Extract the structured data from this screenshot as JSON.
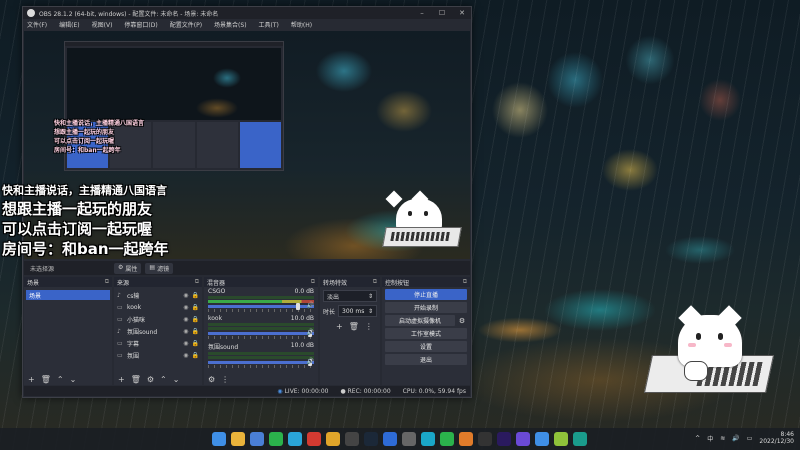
{
  "window": {
    "title": "OBS 28.1.2 (64-bit, windows) - 配置文件: 未命名 - 场景: 未命名",
    "controls": [
      "–",
      "☐",
      "✕"
    ]
  },
  "menu": [
    "文件(F)",
    "编辑(E)",
    "视图(V)",
    "停靠窗口(D)",
    "配置文件(P)",
    "场景集合(S)",
    "工具(T)",
    "帮助(H)"
  ],
  "overlay_lines_small": [
    "快和主播说话，主播精通八国语言",
    "想跟主播一起玩的朋友",
    "可以点击订阅一起玩喔",
    "房间号：和ban一起跨年"
  ],
  "overlay_lines_big": [
    "快和主播说话，主播精通八国语言",
    "想跟主播一起玩的朋友",
    "可以点击订阅一起玩喔",
    "房间号：和ban一起跨年"
  ],
  "scenebar": {
    "scene_label": "未选择源",
    "props_label": "属性",
    "filters_label": "滤镜"
  },
  "docks": {
    "scenes": {
      "title": "场景",
      "items": [
        "场景"
      ]
    },
    "sources": {
      "title": "来源",
      "items": [
        {
          "icon": "♪",
          "label": "cs输"
        },
        {
          "icon": "▭",
          "label": "kook"
        },
        {
          "icon": "▭",
          "label": "小猫咪"
        },
        {
          "icon": "♪",
          "label": "氛围sound"
        },
        {
          "icon": "▭",
          "label": "字幕"
        },
        {
          "icon": "▭",
          "label": "氛围"
        }
      ]
    },
    "mixer": {
      "title": "混音器",
      "channels": [
        {
          "name": "CSGO",
          "db": "0.0 dB"
        },
        {
          "name": "kook",
          "db": "10.0 dB"
        },
        {
          "name": "氛围sound",
          "db": "10.0 dB"
        }
      ]
    },
    "transitions": {
      "title": "转场特效",
      "type": "淡出",
      "duration_label": "时长",
      "duration_value": "300 ms"
    },
    "controls": {
      "title": "控制按钮",
      "buttons": [
        "停止直播",
        "开始录制",
        "启动虚拟摄像机",
        "工作室模式",
        "设置",
        "退出"
      ]
    }
  },
  "status": {
    "live": "LIVE: 00:00:00",
    "rec": "REC: 00:00:00",
    "cpu": "CPU: 0.0%, 59.94 fps"
  },
  "taskbar": {
    "tray_ime": "中",
    "time": "8:46",
    "date": "2022/12/30",
    "icons": [
      {
        "name": "windows-start",
        "color": "#3f8fe6"
      },
      {
        "name": "file-explorer",
        "color": "#e9b33b"
      },
      {
        "name": "store",
        "color": "#4a7fd6"
      },
      {
        "name": "wechat",
        "color": "#2bb24c"
      },
      {
        "name": "edge",
        "color": "#2aa5d8"
      },
      {
        "name": "netease-music",
        "color": "#d33a31"
      },
      {
        "name": "chrome",
        "color": "#e0a52a"
      },
      {
        "name": "obs",
        "color": "#444"
      },
      {
        "name": "steam",
        "color": "#1b2838"
      },
      {
        "name": "app-blue",
        "color": "#2e6bd6"
      },
      {
        "name": "app-gray",
        "color": "#666"
      },
      {
        "name": "app-cyan",
        "color": "#1aa7c9"
      },
      {
        "name": "app-green",
        "color": "#2bb24c"
      },
      {
        "name": "app-orange",
        "color": "#e07b2a"
      },
      {
        "name": "app-dark",
        "color": "#333"
      },
      {
        "name": "premiere",
        "color": "#2a1a5e"
      },
      {
        "name": "app-purple",
        "color": "#6b4ad6"
      },
      {
        "name": "app-blue2",
        "color": "#3f8fe6"
      },
      {
        "name": "app-lime",
        "color": "#8fc23a"
      },
      {
        "name": "app-teal",
        "color": "#1a9c8c"
      }
    ]
  }
}
